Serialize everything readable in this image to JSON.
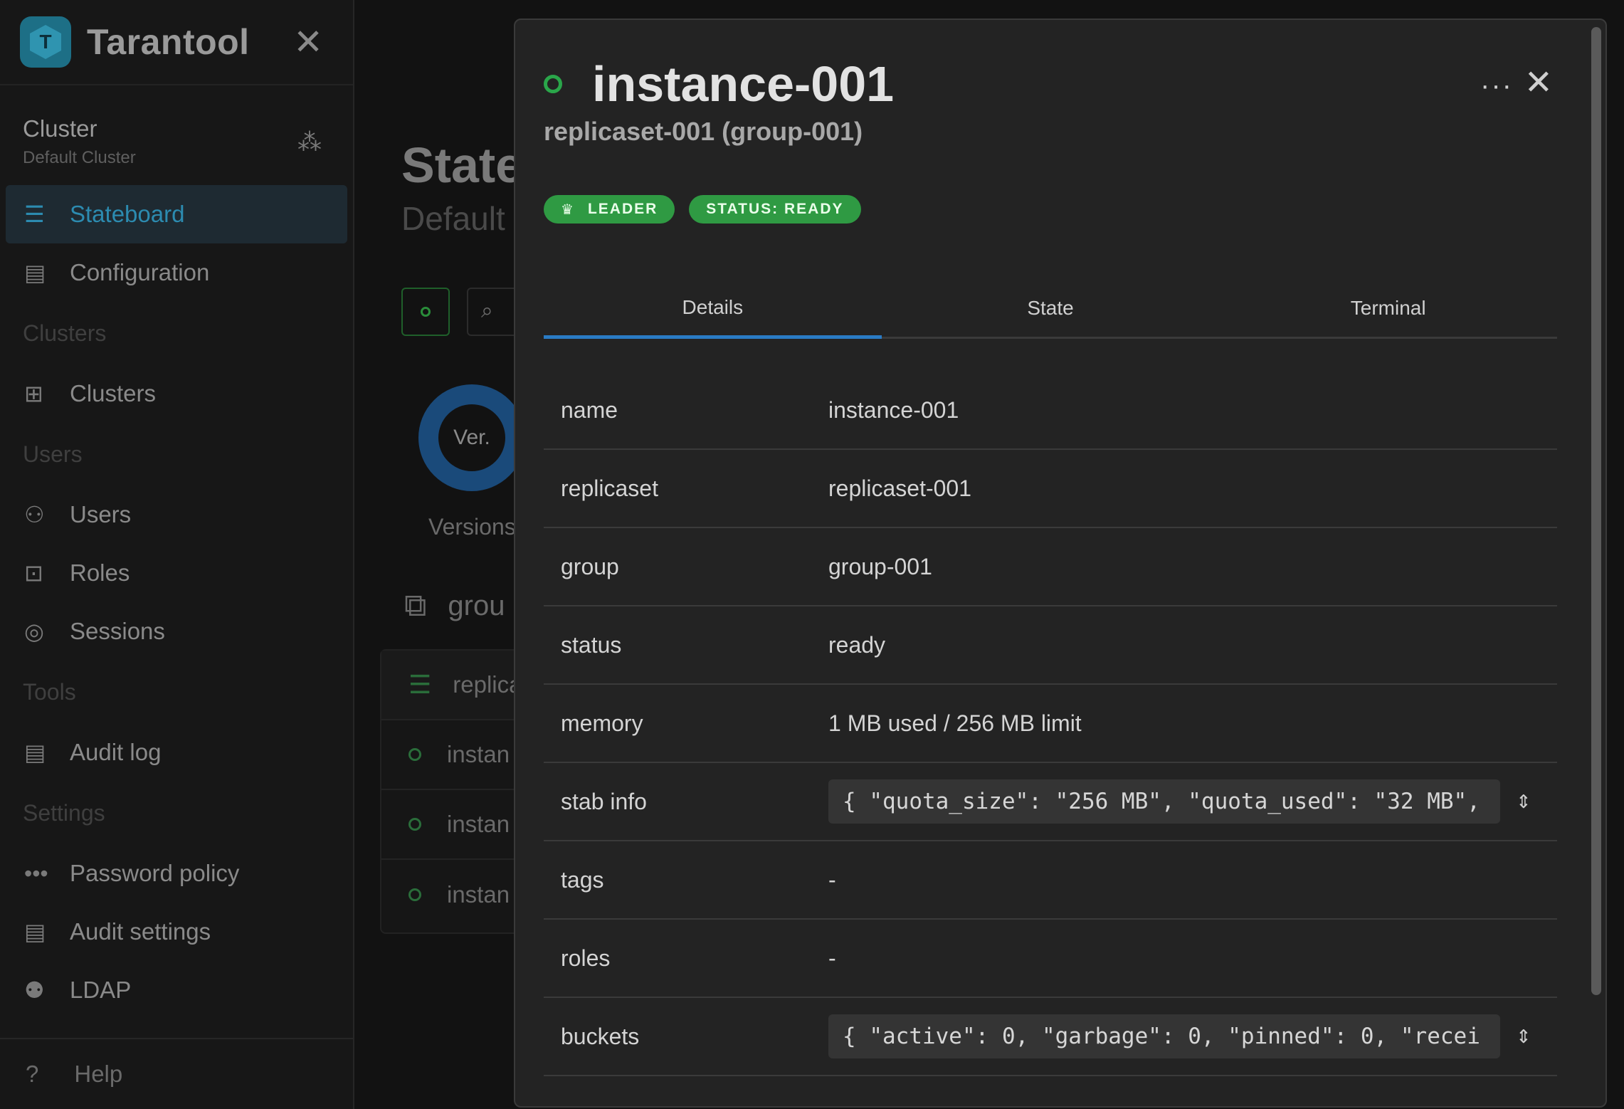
{
  "sidebar": {
    "brand": "Tarantool",
    "cluster": {
      "title": "Cluster",
      "subtitle": "Default Cluster"
    },
    "items": {
      "stateboard": "Stateboard",
      "configuration": "Configuration",
      "clusters_section": "Clusters",
      "clusters": "Clusters",
      "users_section": "Users",
      "users": "Users",
      "roles": "Roles",
      "sessions": "Sessions",
      "tools_section": "Tools",
      "audit_log": "Audit log",
      "settings_section": "Settings",
      "password_policy": "Password policy",
      "audit_settings": "Audit settings",
      "ldap": "LDAP"
    },
    "help": "Help"
  },
  "main": {
    "title": "State",
    "subtitle": "Default C",
    "donut_label": "Ver.",
    "versions_label": "Versions",
    "group_label": "grou",
    "replicaset_label": "replica",
    "instances": [
      "instan",
      "instan",
      "instan"
    ]
  },
  "drawer": {
    "title": "instance-001",
    "subtitle": "replicaset-001 (group-001)",
    "more_glyph": "···",
    "badges": {
      "leader": "LEADER",
      "status": "STATUS: READY"
    },
    "tabs": [
      "Details",
      "State",
      "Terminal"
    ],
    "active_tab": "Details",
    "details": {
      "name": {
        "key": "name",
        "value": "instance-001"
      },
      "replicaset": {
        "key": "replicaset",
        "value": "replicaset-001"
      },
      "group": {
        "key": "group",
        "value": "group-001"
      },
      "status": {
        "key": "status",
        "value": "ready"
      },
      "memory": {
        "key": "memory",
        "value": "1 MB used / 256 MB limit"
      },
      "stab_info": {
        "key": "stab info",
        "value": "{ \"quota_size\": \"256 MB\", \"quota_used\": \"32 MB\","
      },
      "tags": {
        "key": "tags",
        "value": "-"
      },
      "roles": {
        "key": "roles",
        "value": "-"
      },
      "buckets": {
        "key": "buckets",
        "value": "{ \"active\": 0, \"garbage\": 0, \"pinned\": 0, \"recei"
      }
    }
  },
  "colors": {
    "accent_blue": "#2a7bc4",
    "success_green": "#2f9a43",
    "sidebar_active": "#2c8bb0"
  }
}
